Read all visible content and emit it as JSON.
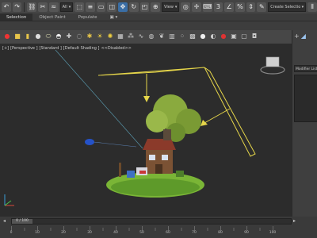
{
  "toolbar": {
    "view_dropdown": "View",
    "selection_set_placeholder": "Create Selection Se",
    "snap_labels": [
      "3",
      "2.",
      "%"
    ]
  },
  "ribbon": {
    "tabs": [
      "Selection",
      "Object Paint",
      "Populate"
    ]
  },
  "viewport": {
    "labels": [
      "[+]",
      "[Perspective ]",
      "[Standard ]",
      "[Default Shading ]",
      "<<Disabled>>"
    ]
  },
  "command_panel": {
    "modifier_list_label": "Modifier List"
  },
  "timeline": {
    "frame_indicator": "0 / 100",
    "ticks": [
      "0",
      "10",
      "20",
      "30",
      "40",
      "50",
      "60",
      "70",
      "80",
      "90",
      "100"
    ]
  },
  "colors": {
    "accent": "#3a6ea5",
    "viewport_bg": "#2c2c2c",
    "light_gizmo": "#e6d64a",
    "target_blue": "#2552c8"
  }
}
